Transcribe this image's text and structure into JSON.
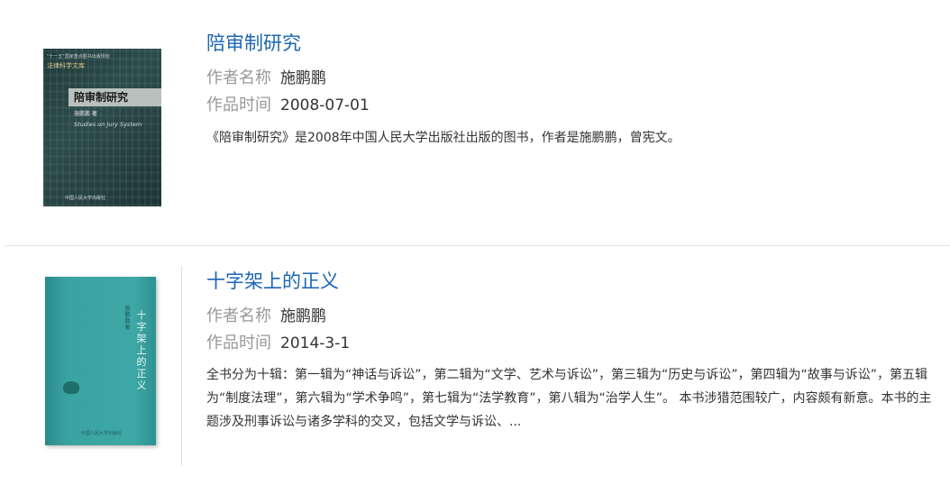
{
  "books": [
    {
      "title": "陪审制研究",
      "author_label": "作者名称",
      "author": "施鹏鹏",
      "date_label": "作品时间",
      "date": "2008-07-01",
      "description": "《陪审制研究》是2008年中国人民大学出版社出版的图书，作者是施鹏鹏，曾宪文。",
      "cover": {
        "top_line": "\"十一五\"国家重点图书出版规划",
        "series": "法律科学文库",
        "title": "陪审制研究",
        "author": "施鹏鹏 著",
        "english": "Studies on Jury System",
        "publisher": "中国人民大学出版社"
      }
    },
    {
      "title": "十字架上的正义",
      "author_label": "作者名称",
      "author": "施鹏鹏",
      "date_label": "作品时间",
      "date": "2014-3-1",
      "description": "全书分为十辑：第一辑为“神话与诉讼”，第二辑为“文学、艺术与诉讼”，第三辑为“历史与诉讼”，第四辑为“故事与诉讼”，第五辑为“制度法理”，第六辑为“学术争鸣”，第七辑为“法学教育”，第八辑为“治学人生”。 本书涉猎范围较广，内容颇有新意。本书的主题涉及刑事诉讼与诸多学科的交叉，包括文学与诉讼、...",
      "cover": {
        "title": "十字架上的正义",
        "author": "施鹏鹏 著",
        "publisher": "中国人民大学出版社"
      }
    }
  ]
}
